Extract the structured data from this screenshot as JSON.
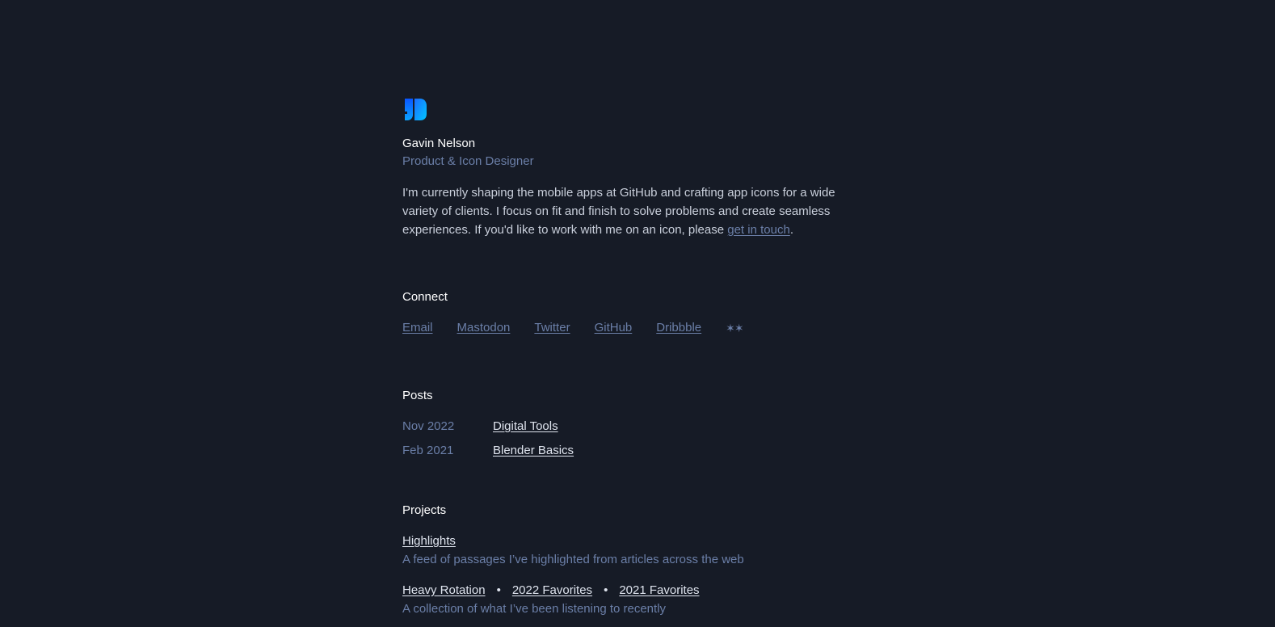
{
  "profile": {
    "name": "Gavin Nelson",
    "role": "Product & Icon Designer",
    "bio_text": "I'm currently shaping the mobile apps at GitHub and crafting app icons for a wide variety of clients. I focus on fit and finish to solve problems and create seamless experiences. If you'd like to work with me on an icon, please ",
    "bio_link": "get in touch",
    "bio_end": "."
  },
  "connect": {
    "title": "Connect",
    "links": [
      "Email",
      "Mastodon",
      "Twitter",
      "GitHub",
      "Dribbble"
    ],
    "symbol": "✶✶"
  },
  "posts": {
    "title": "Posts",
    "items": [
      {
        "date": "Nov 2022",
        "title": "Digital Tools"
      },
      {
        "date": "Feb 2021",
        "title": "Blender Basics"
      }
    ]
  },
  "projects": {
    "title": "Projects",
    "items": [
      {
        "links": [
          "Highlights"
        ],
        "description": "A feed of passages I’ve highlighted from articles across the web"
      },
      {
        "links": [
          "Heavy Rotation",
          "2022 Favorites",
          "2021 Favorites"
        ],
        "separator": "•",
        "description": "A collection of what I’ve been listening to recently"
      }
    ]
  },
  "colors": {
    "background": "#161b26",
    "accent_muted": "#6b7fa8",
    "logo_gradient_start": "#1877ff",
    "logo_gradient_end": "#00c8ff"
  },
  "icons": {
    "logo": "gn-monogram-logo"
  }
}
